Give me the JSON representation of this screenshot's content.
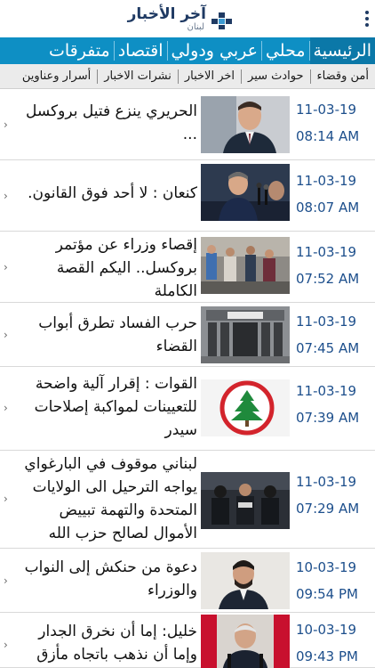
{
  "app": {
    "logo_title": "آخر الأخبار",
    "logo_subtitle": "لبنان"
  },
  "main_nav": [
    {
      "label": "الرئيسية"
    },
    {
      "label": "محلي"
    },
    {
      "label": "عربي ودولي"
    },
    {
      "label": "اقتصاد"
    },
    {
      "label": "متفرقات"
    }
  ],
  "sub_nav": [
    {
      "label": "أمن وقضاء"
    },
    {
      "label": "حوادث سير"
    },
    {
      "label": "اخر الاخبار"
    },
    {
      "label": "نشرات الاخبار"
    },
    {
      "label": "أسرار وعناوين"
    }
  ],
  "news": [
    {
      "headline": "الحريري ينزع فتيل بروكسل ...",
      "date": "11-03-19",
      "time": "08:14 AM",
      "thumb": "portrait-suit-dark"
    },
    {
      "headline": "كنعان : لا أحد فوق القانون.",
      "date": "11-03-19",
      "time": "08:07 AM",
      "thumb": "speaker-microphones"
    },
    {
      "headline": "إقصاء وزراء عن مؤتمر بروكسل.. اليكم القصة الكاملة",
      "date": "11-03-19",
      "time": "07:52 AM",
      "thumb": "crowd-street"
    },
    {
      "headline": "حرب الفساد تطرق أبواب القضاء",
      "date": "11-03-19",
      "time": "07:45 AM",
      "thumb": "palace-of-justice"
    },
    {
      "headline": "القوات : إقرار آلية واضحة للتعيينات لمواكبة إصلاحات سيدر",
      "date": "11-03-19",
      "time": "07:39 AM",
      "thumb": "cedar-logo"
    },
    {
      "headline": "لبناني موقوف في البارغواي يواجه الترحيل الى الولايات المتحدة والتهمة تبييض الأموال لصالح حزب الله",
      "date": "11-03-19",
      "time": "07:29 AM",
      "thumb": "police-arrest"
    },
    {
      "headline": "دعوة من حنكش إلى النواب والوزراء",
      "date": "10-03-19",
      "time": "09:54 PM",
      "thumb": "portrait-beard"
    },
    {
      "headline": "خليل: إما أن نخرق الجدار وإما أن نذهب باتجاه مأزق",
      "date": "10-03-19",
      "time": "09:43 PM",
      "thumb": "speaker-flags"
    }
  ]
}
